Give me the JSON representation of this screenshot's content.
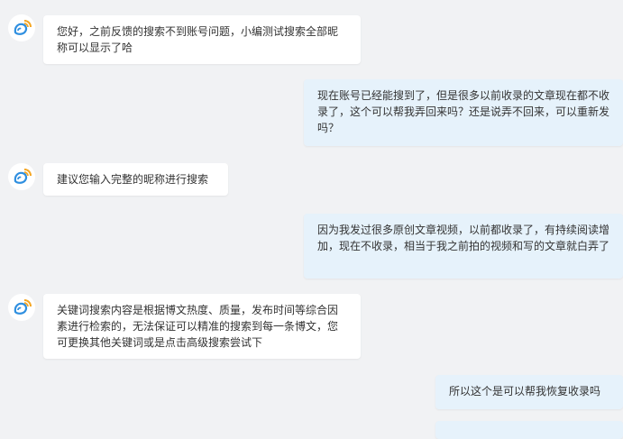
{
  "chat": {
    "messages": [
      {
        "from": "agent",
        "text": "您好，之前反馈的搜索不到账号问题，小编测试搜索全部昵称可以显示了哈"
      },
      {
        "from": "user",
        "text": "现在账号已经能搜到了，但是很多以前收录的文章现在都不收录了，这个可以帮我弄回来吗？还是说弄不回来，可以重新发吗？"
      },
      {
        "from": "agent",
        "text": "建议您输入完整的昵称进行搜索"
      },
      {
        "from": "user",
        "text": "因为我发过很多原创文章视频，以前都收录了，有持续阅读增加，现在不收录，相当于我之前拍的视频和写的文章就白弄了"
      },
      {
        "from": "agent",
        "text": "关键词搜索内容是根据博文热度、质量，发布时间等综合因素进行检索的，无法保证可以精准的搜索到每一条博文，您可更换其他关键词或是点击高级搜索尝试下"
      },
      {
        "from": "user",
        "text": "所以这个是可以帮我恢复收录吗"
      }
    ]
  },
  "colors": {
    "page_background": "#f1f2f4",
    "agent_bubble": "#ffffff",
    "user_bubble": "#e6f2fb",
    "avatar_blue": "#2f8fe0",
    "avatar_orange": "#f5a623"
  },
  "icons": {
    "agent_avatar": "weibo-support-avatar-icon"
  }
}
